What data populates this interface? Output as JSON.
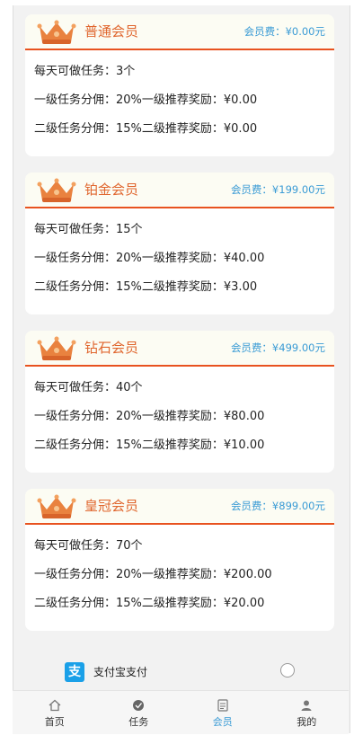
{
  "memberships": [
    {
      "name": "普通会员",
      "fee": "会员费：¥0.00元",
      "daily_tasks": "每天可做任务：3个",
      "level1": "一级任务分佣：20%一级推荐奖励：¥0.00",
      "level2": "二级任务分佣：15%二级推荐奖励：¥0.00"
    },
    {
      "name": "铂金会员",
      "fee": "会员费：¥199.00元",
      "daily_tasks": "每天可做任务：15个",
      "level1": "一级任务分佣：20%一级推荐奖励：¥40.00",
      "level2": "二级任务分佣：15%二级推荐奖励：¥3.00"
    },
    {
      "name": "钻石会员",
      "fee": "会员费：¥499.00元",
      "daily_tasks": "每天可做任务：40个",
      "level1": "一级任务分佣：20%一级推荐奖励：¥80.00",
      "level2": "二级任务分佣：15%二级推荐奖励：¥10.00"
    },
    {
      "name": "皇冠会员",
      "fee": "会员费：¥899.00元",
      "daily_tasks": "每天可做任务：70个",
      "level1": "一级任务分佣：20%一级推荐奖励：¥200.00",
      "level2": "二级任务分佣：15%二级推荐奖励：¥20.00"
    }
  ],
  "payment": {
    "icon": "alipay-icon",
    "icon_glyph": "支",
    "label": "支付宝支付",
    "selected": false
  },
  "tabbar": {
    "items": [
      {
        "label": "首页",
        "icon": "home-icon"
      },
      {
        "label": "任务",
        "icon": "task-icon"
      },
      {
        "label": "会员",
        "icon": "member-icon"
      },
      {
        "label": "我的",
        "icon": "user-icon"
      }
    ],
    "active_index": 2
  },
  "colors": {
    "accent": "#3a9bd5",
    "level_title": "#e0662e",
    "divider": "#e8521f",
    "alipay": "#1aa0e8"
  }
}
